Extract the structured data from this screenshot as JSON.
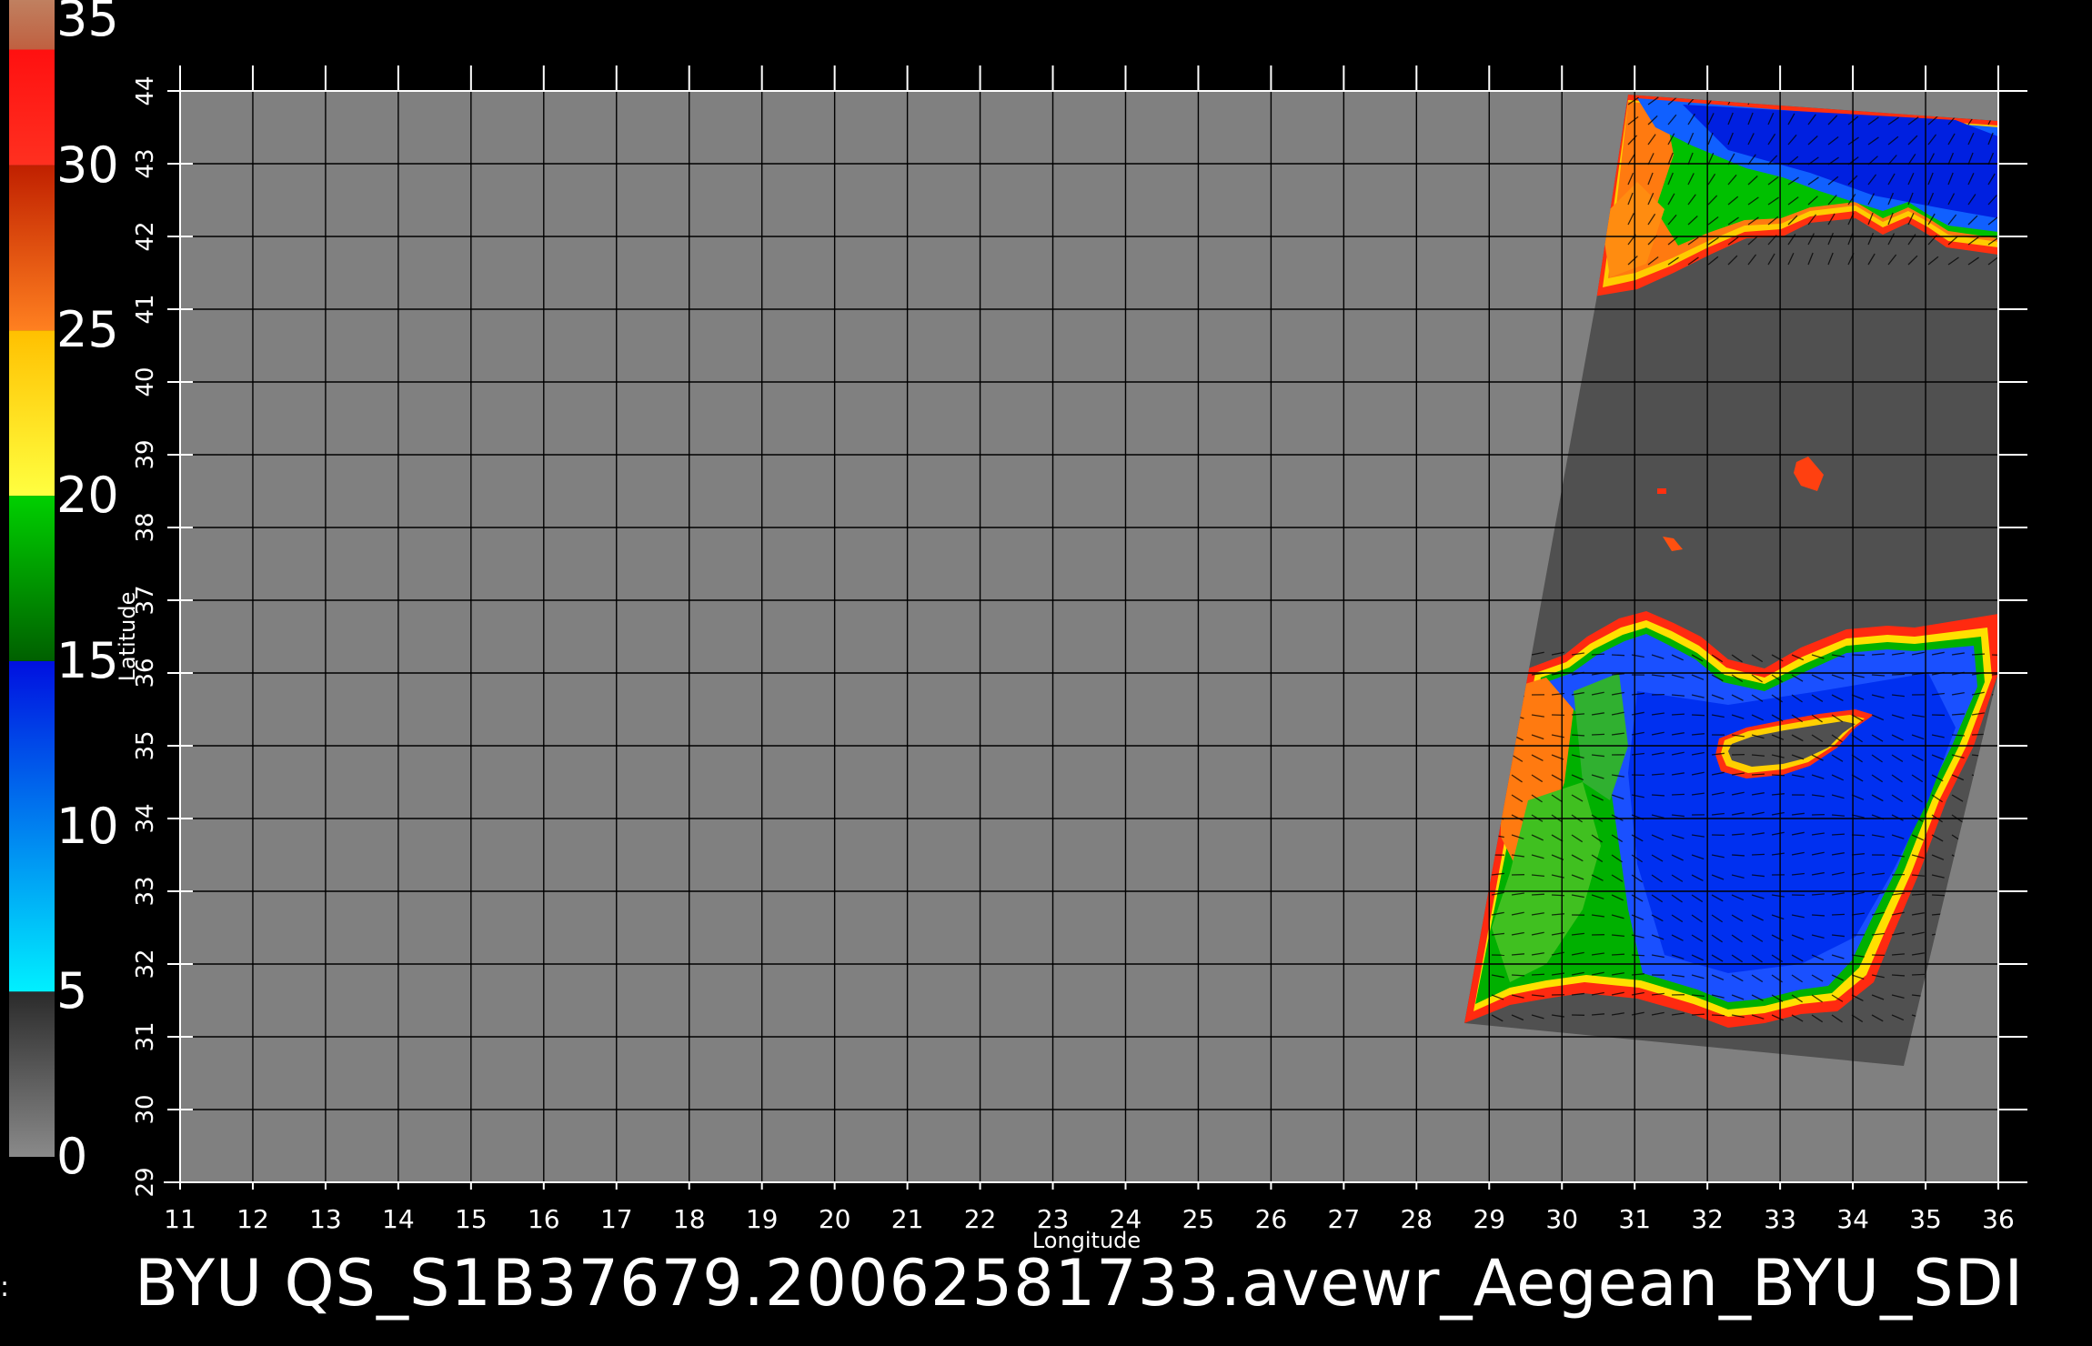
{
  "caption": "BYU  QS_S1B37679.20062581733.avewr_Aegean_BYU_SDI",
  "edge_mark": ":",
  "colorbar": {
    "min": 0,
    "max": 35,
    "labels": [
      "35",
      "30",
      "25",
      "20",
      "15",
      "10",
      "5",
      "0"
    ],
    "label_values": [
      35,
      30,
      25,
      20,
      15,
      10,
      5,
      0
    ],
    "bands": [
      {
        "from": 0,
        "to": 5,
        "color_top": "#2a2a2a",
        "color_bottom": "#8a8a8a"
      },
      {
        "from": 5,
        "to": 15,
        "color_top": "#0010e0",
        "color_bottom": "#00f0ff"
      },
      {
        "from": 15,
        "to": 20,
        "color_top": "#00d000",
        "color_bottom": "#006000"
      },
      {
        "from": 20,
        "to": 25,
        "color_top": "#ffc000",
        "color_bottom": "#ffff40"
      },
      {
        "from": 25,
        "to": 30,
        "color_top": "#c02000",
        "color_bottom": "#ff8020"
      },
      {
        "from": 30,
        "to": 33.5,
        "color_top": "#ff1010",
        "color_bottom": "#ff3020"
      },
      {
        "from": 33.5,
        "to": 35,
        "color_top": "#c08060",
        "color_bottom": "#c06040"
      }
    ]
  },
  "map": {
    "xlabel": "Longitude",
    "ylabel": "Latitude",
    "lon_range": [
      11,
      36
    ],
    "lat_range": [
      29,
      44
    ],
    "lon_ticks": [
      "11",
      "12",
      "13",
      "14",
      "15",
      "16",
      "17",
      "18",
      "19",
      "20",
      "21",
      "22",
      "23",
      "24",
      "25",
      "26",
      "27",
      "28",
      "29",
      "30",
      "31",
      "32",
      "33",
      "34",
      "35",
      "36"
    ],
    "lat_ticks": [
      "29",
      "30",
      "31",
      "32",
      "33",
      "34",
      "35",
      "36",
      "37",
      "38",
      "39",
      "40",
      "41",
      "42",
      "43",
      "44"
    ],
    "background_color": "#808080",
    "swath_color": "#505050",
    "grid_color": "#000000"
  }
}
